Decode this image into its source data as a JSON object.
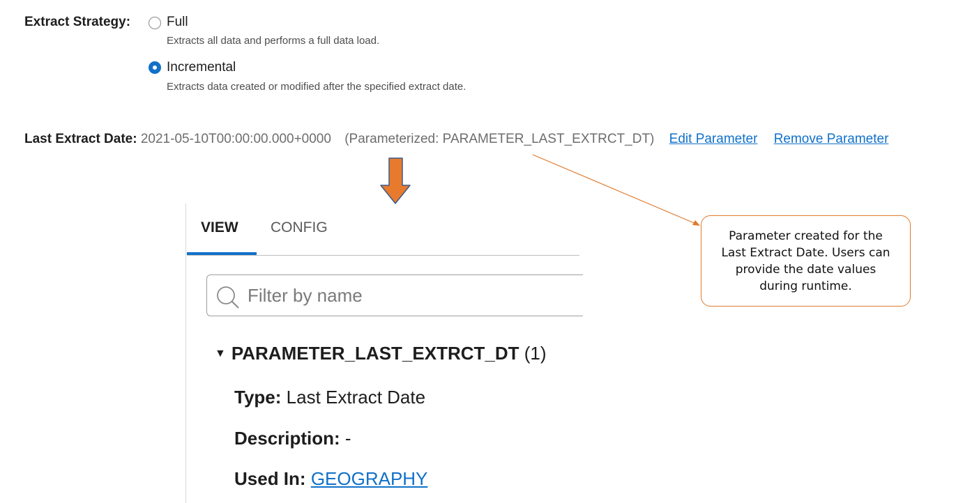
{
  "extract_strategy": {
    "label": "Extract Strategy:",
    "options": [
      {
        "label": "Full",
        "description": "Extracts all data and performs a full data load.",
        "selected": false
      },
      {
        "label": "Incremental",
        "description": "Extracts data created or modified after the specified extract date.",
        "selected": true
      }
    ]
  },
  "last_extract_date": {
    "label": "Last Extract Date:",
    "value": "2021-05-10T00:00:00.000+0000",
    "parameterized": "(Parameterized: PARAMETER_LAST_EXTRCT_DT)",
    "edit_link": "Edit Parameter",
    "remove_link": "Remove Parameter"
  },
  "panel": {
    "tabs": [
      {
        "label": "VIEW",
        "active": true
      },
      {
        "label": "CONFIG",
        "active": false
      }
    ],
    "filter_placeholder": "Filter by name",
    "parameter": {
      "name": "PARAMETER_LAST_EXTRCT_DT",
      "count": "(1)",
      "type_label": "Type:",
      "type_value": "Last Extract Date",
      "description_label": "Description:",
      "description_value": "-",
      "used_in_label": "Used In:",
      "used_in_value": "GEOGRAPHY"
    }
  },
  "callout": {
    "text": "Parameter created for the Last Extract Date. Users can provide the date values during runtime."
  },
  "colors": {
    "accent": "#1071c9",
    "callout_border": "#e07a2e",
    "arrow_fill": "#e87a2e",
    "arrow_outline": "#3a5a88"
  },
  "icons": [
    "search-icon",
    "caret-down-icon",
    "down-arrow-icon",
    "callout-pointer"
  ]
}
